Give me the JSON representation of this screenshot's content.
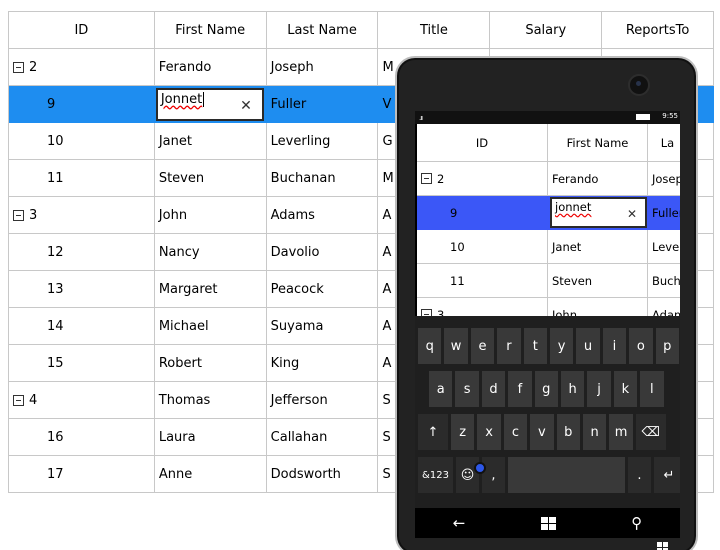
{
  "grid": {
    "columns": [
      "ID",
      "First Name",
      "Last Name",
      "Title",
      "Salary",
      "ReportsTo"
    ],
    "rows": [
      {
        "kind": "group",
        "id": "2",
        "first": "Ferando",
        "last": "Joseph",
        "title": "M"
      },
      {
        "kind": "editing",
        "id": "9",
        "edit_value": "Jonnet",
        "last": "Fuller",
        "title": "V"
      },
      {
        "kind": "child",
        "id": "10",
        "first": "Janet",
        "last": "Leverling",
        "title": "G"
      },
      {
        "kind": "child",
        "id": "11",
        "first": "Steven",
        "last": "Buchanan",
        "title": "M"
      },
      {
        "kind": "group",
        "id": "3",
        "first": "John",
        "last": "Adams",
        "title": "A"
      },
      {
        "kind": "child",
        "id": "12",
        "first": "Nancy",
        "last": "Davolio",
        "title": "A"
      },
      {
        "kind": "child",
        "id": "13",
        "first": "Margaret",
        "last": "Peacock",
        "title": "A"
      },
      {
        "kind": "child",
        "id": "14",
        "first": "Michael",
        "last": "Suyama",
        "title": "A"
      },
      {
        "kind": "child",
        "id": "15",
        "first": "Robert",
        "last": "King",
        "title": "A"
      },
      {
        "kind": "group",
        "id": "4",
        "first": "Thomas",
        "last": "Jefferson",
        "title": "S"
      },
      {
        "kind": "child",
        "id": "16",
        "first": "Laura",
        "last": "Callahan",
        "title": "S"
      },
      {
        "kind": "child",
        "id": "17",
        "first": "Anne",
        "last": "Dodsworth",
        "title": "S"
      }
    ]
  },
  "phone": {
    "status": {
      "signal": ".ıı",
      "time": "9:55"
    },
    "grid": {
      "columns": [
        "ID",
        "First Name",
        "La"
      ],
      "rows": [
        {
          "kind": "group",
          "id": "2",
          "first": "Ferando",
          "last": "Josep"
        },
        {
          "kind": "editing",
          "id": "9",
          "edit_value": "jonnet",
          "last": "Fuller"
        },
        {
          "kind": "child",
          "id": "10",
          "first": "Janet",
          "last": "Lever"
        },
        {
          "kind": "child",
          "id": "11",
          "first": "Steven",
          "last": "Bucha"
        },
        {
          "kind": "group",
          "id": "3",
          "first": "John",
          "last": "Adam"
        }
      ]
    },
    "keyboard": {
      "row1": [
        "q",
        "w",
        "e",
        "r",
        "t",
        "y",
        "u",
        "i",
        "o",
        "p"
      ],
      "row2": [
        "a",
        "s",
        "d",
        "f",
        "g",
        "h",
        "j",
        "k",
        "l"
      ],
      "row3": [
        "↑",
        "z",
        "x",
        "c",
        "v",
        "b",
        "n",
        "m",
        "⌫"
      ],
      "row4": [
        "&123",
        "☺",
        ",",
        "",
        ".",
        "↵"
      ]
    },
    "nav": {
      "back": "←",
      "search": "⚲"
    },
    "accent_color": "#1e8df0",
    "phone_accent_color": "#3b57f7"
  }
}
